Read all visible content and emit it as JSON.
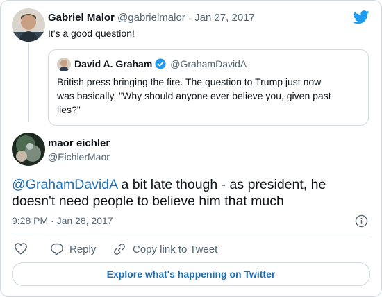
{
  "parent_tweet": {
    "name": "Gabriel Malor",
    "handle": "@gabrielmalor",
    "separator": "·",
    "date": "Jan 27, 2017",
    "text": "It's a good question!"
  },
  "quoted_tweet": {
    "name": "David A. Graham",
    "handle": "@GrahamDavidA",
    "verified": true,
    "text_line1": "British press bringing the fire. The question to Trump just now",
    "text_line2": "was basically, \"Why should anyone ever believe you, given past",
    "text_line3": "lies?\""
  },
  "main_tweet": {
    "name": "maor eichler",
    "handle": "@EichlerMaor",
    "mention": "@GrahamDavidA",
    "text_after_mention": " a bit late though - as president, he",
    "text_line2": "doesn't need people to believe him that much",
    "time": "9:28 PM",
    "separator": "·",
    "date": "Jan 28, 2017"
  },
  "actions": {
    "reply_label": "Reply",
    "copy_link_label": "Copy link to Tweet"
  },
  "explore_button_label": "Explore what's happening on Twitter",
  "colors": {
    "accent": "#1d9bf0",
    "link": "#1d6fb5",
    "border": "#cfd9de",
    "muted": "#536471"
  }
}
